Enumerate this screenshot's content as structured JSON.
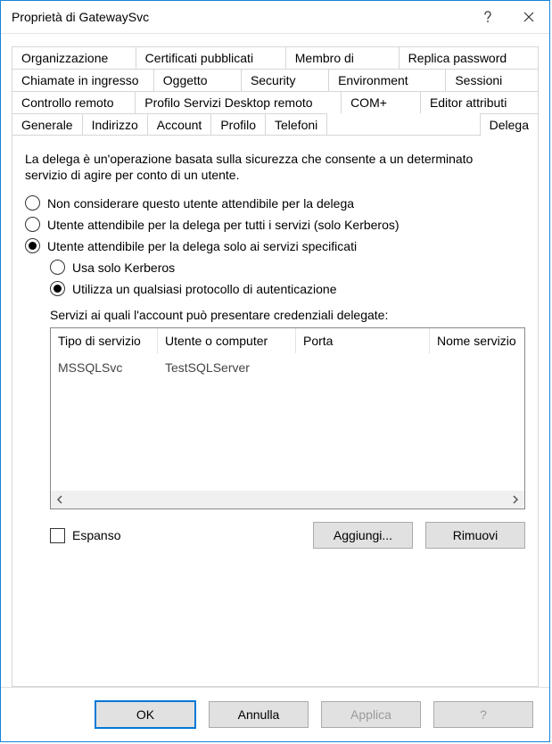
{
  "window": {
    "title": "Proprietà di GatewaySvc"
  },
  "tabs": {
    "row1": [
      "Organizzazione",
      "Certificati pubblicati",
      "Membro di",
      "Replica password"
    ],
    "row2": [
      "Chiamate in ingresso",
      "Oggetto",
      "Security",
      "Environment",
      "Sessioni"
    ],
    "row3": [
      "Controllo remoto",
      "Profilo Servizi Desktop remoto",
      "COM+",
      "Editor attributi"
    ],
    "row4": [
      "Generale",
      "Indirizzo",
      "Account",
      "Profilo",
      "Telefoni",
      "Delega"
    ],
    "active": "Delega"
  },
  "page": {
    "intro": "La delega è un'operazione basata sulla sicurezza che consente a un determinato servizio di agire per conto di un utente.",
    "opt_no_trust": "Non considerare questo utente attendibile per la delega",
    "opt_any_service": "Utente attendibile per la delega per tutti i servizi (solo Kerberos)",
    "opt_specified": "Utente attendibile per la delega solo ai servizi specificati",
    "sub_kerberos_only": "Usa solo Kerberos",
    "sub_any_protocol": "Utilizza un qualsiasi protocollo di autenticazione",
    "list_label": "Servizi ai quali l'account può presentare credenziali delegate:",
    "columns": {
      "c0": "Tipo di servizio",
      "c1": "Utente o computer",
      "c2": "Porta",
      "c3": "Nome servizio"
    },
    "row0": {
      "c0": "MSSQLSvc",
      "c1": "TestSQLServer",
      "c2": "",
      "c3": ""
    },
    "expanded_label": "Espanso",
    "add_label": "Aggiungi...",
    "remove_label": "Rimuovi"
  },
  "buttons": {
    "ok": "OK",
    "cancel": "Annulla",
    "apply": "Applica",
    "help": "?"
  }
}
